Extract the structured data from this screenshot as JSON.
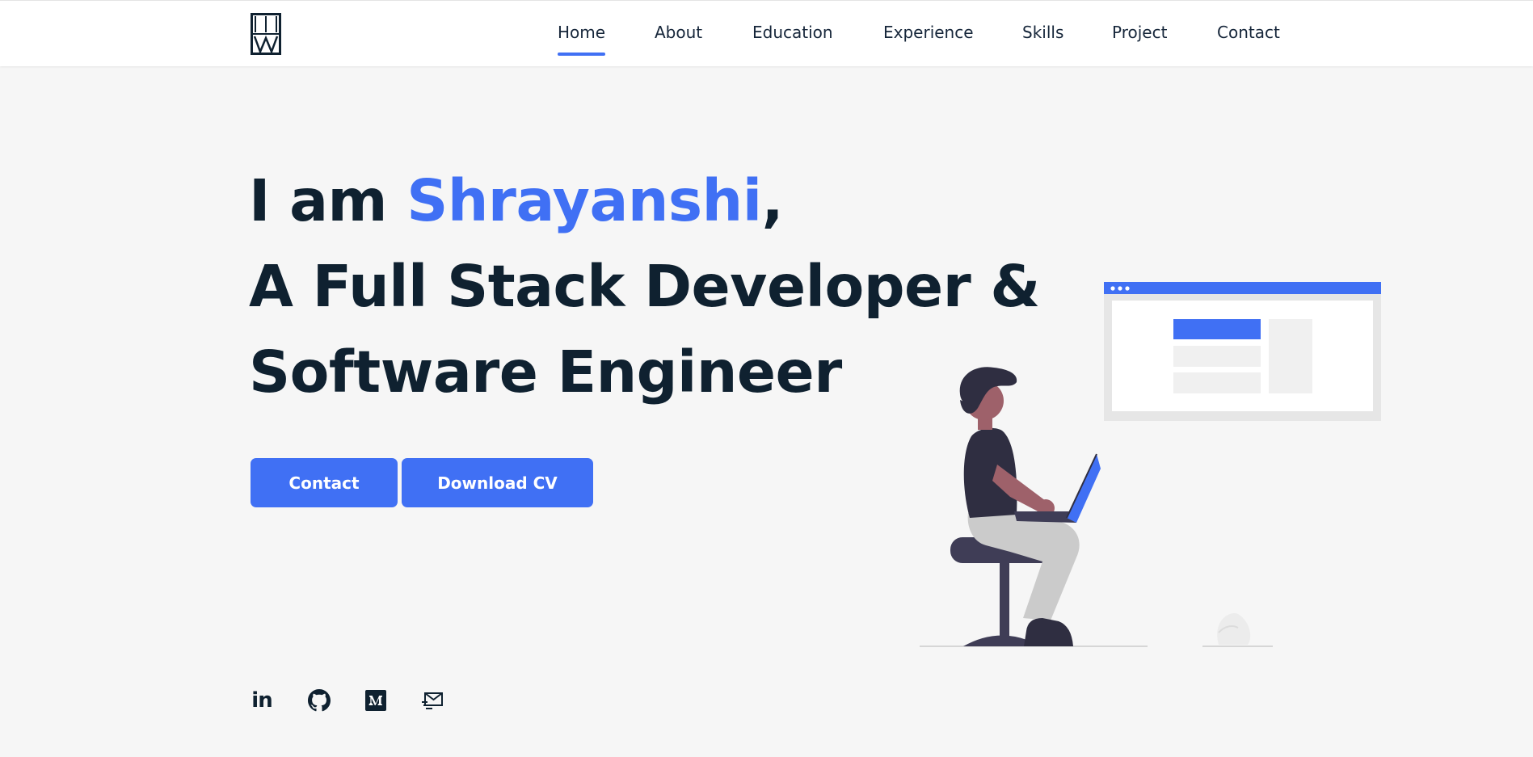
{
  "nav": {
    "items": [
      {
        "label": "Home",
        "active": true
      },
      {
        "label": "About"
      },
      {
        "label": "Education"
      },
      {
        "label": "Experience"
      },
      {
        "label": "Skills"
      },
      {
        "label": "Project"
      },
      {
        "label": "Contact"
      }
    ]
  },
  "hero": {
    "greeting_prefix": "I am ",
    "name": "Shrayanshi",
    "greeting_suffix": ",",
    "line2": "A Full Stack Developer &",
    "line3": "Software Engineer"
  },
  "buttons": {
    "contact": "Contact",
    "download_cv": "Download CV"
  },
  "social": {
    "linkedin_text": "in"
  },
  "colors": {
    "accent": "#4070f4",
    "text": "#0f2130",
    "background": "#f6f6f6"
  },
  "icons": [
    "logo-icon",
    "linkedin-icon",
    "github-icon",
    "medium-icon",
    "mail-icon"
  ]
}
